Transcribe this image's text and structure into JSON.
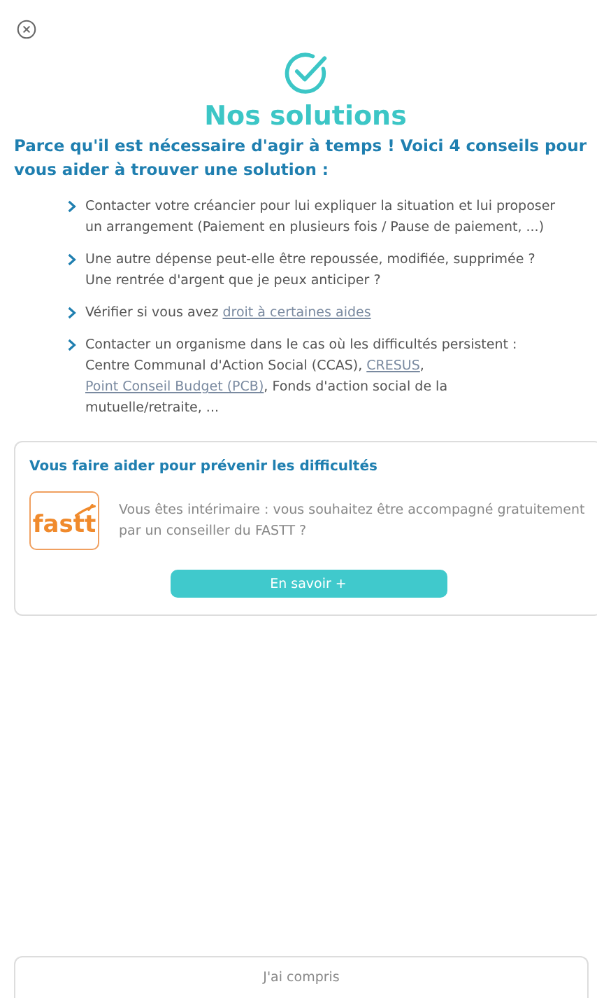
{
  "title": "Nos solutions",
  "intro": "Parce qu'il est nécessaire d'agir à temps ! Voici 4 conseils pour vous aider à trouver une solution :",
  "tips": [
    [
      {
        "kind": "text",
        "text": "Contacter votre créancier pour lui expliquer la situation et lui proposer un arrangement (Paiement en plusieurs fois / Pause de paiement, ...)"
      }
    ],
    [
      {
        "kind": "text",
        "text": "Une autre dépense peut-elle être repoussée, modifiée, supprimée ? Une rentrée d'argent que je peux anticiper ?"
      }
    ],
    [
      {
        "kind": "text",
        "text": "Vérifier si vous avez"
      },
      {
        "kind": "link",
        "text": "droit à certaines aides"
      }
    ],
    [
      {
        "kind": "text",
        "text": "Contacter un organisme dans le cas où les difficultés persistent : Centre Communal d'Action Social (CCAS),"
      },
      {
        "kind": "link",
        "text": "CRESUS"
      },
      {
        "kind": "text",
        "text": ","
      },
      {
        "kind": "link",
        "text": "Point Conseil Budget (PCB)"
      },
      {
        "kind": "text",
        "text": ", Fonds d'action social de la mutuelle/retraite, ..."
      }
    ]
  ],
  "card": {
    "title": "Vous faire aider pour prévenir les difficultés",
    "logo": "fastt",
    "text": "Vous êtes intérimaire : vous souhaitez être accompagné gratuitement par un conseiller du FASTT ?",
    "button": "En savoir +"
  },
  "footer_button": "J'ai compris"
}
